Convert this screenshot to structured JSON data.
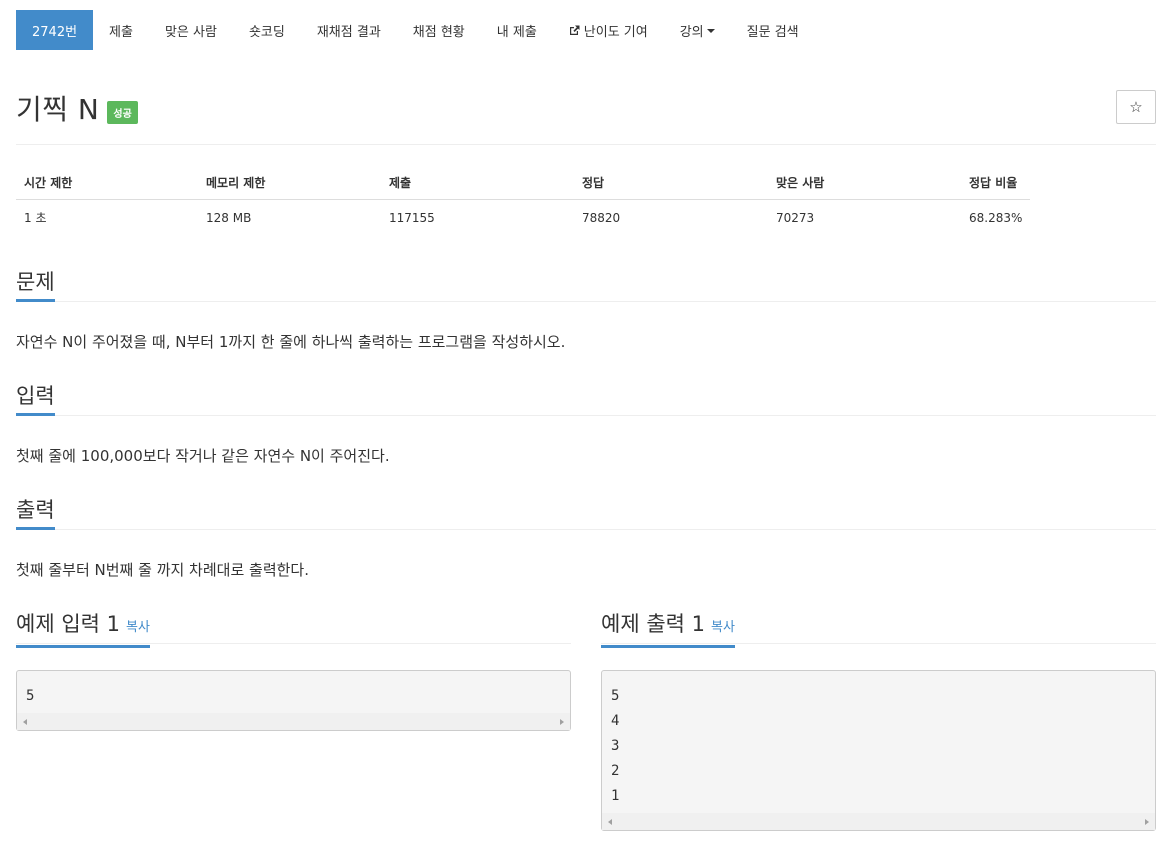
{
  "nav": {
    "items": [
      {
        "label": "2742번",
        "active": true
      },
      {
        "label": "제출"
      },
      {
        "label": "맞은 사람"
      },
      {
        "label": "숏코딩"
      },
      {
        "label": "재채점 결과"
      },
      {
        "label": "채점 현황"
      },
      {
        "label": "내 제출"
      },
      {
        "label": "난이도 기여",
        "icon": "external-link-icon"
      },
      {
        "label": "강의",
        "icon": "caret-down-icon"
      },
      {
        "label": "질문 검색"
      }
    ]
  },
  "problem": {
    "title": "기찍 N",
    "status": "성공",
    "status_color": "#5cb85c",
    "star_icon": "☆"
  },
  "info": {
    "headers": [
      "시간 제한",
      "메모리 제한",
      "제출",
      "정답",
      "맞은 사람",
      "정답 비율"
    ],
    "values": [
      "1 초",
      "128 MB",
      "117155",
      "78820",
      "70273",
      "68.283%"
    ]
  },
  "sections": {
    "problem_title": "문제",
    "problem_text": "자연수 N이 주어졌을 때, N부터 1까지 한 줄에 하나씩 출력하는 프로그램을 작성하시오.",
    "input_title": "입력",
    "input_text": "첫째 줄에 100,000보다 작거나 같은 자연수 N이 주어진다.",
    "output_title": "출력",
    "output_text": "첫째 줄부터 N번째 줄 까지 차례대로 출력한다."
  },
  "samples": {
    "input_title": "예제 입력 1",
    "output_title": "예제 출력 1",
    "copy_label": "복사",
    "input_value": "5",
    "output_value": "5\n4\n3\n2\n1"
  },
  "colors": {
    "accent": "#428bca",
    "success": "#5cb85c"
  }
}
